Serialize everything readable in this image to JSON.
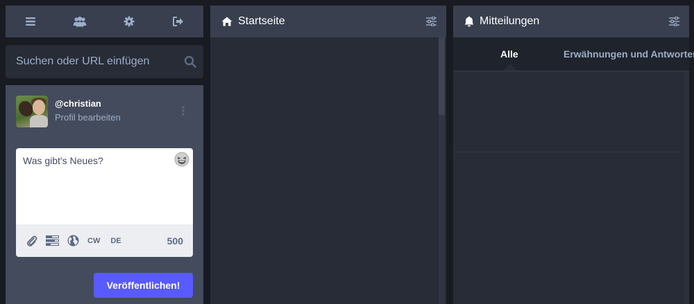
{
  "header": {
    "icons": [
      "menu-icon",
      "users-icon",
      "gear-icon",
      "sign-out-icon"
    ]
  },
  "search": {
    "placeholder": "Suchen oder URL einfügen"
  },
  "account": {
    "username": "@christian",
    "edit_profile": "Profil bearbeiten"
  },
  "compose": {
    "placeholder": "Was gibt's Neues?",
    "cw_label": "CW",
    "lang_label": "DE",
    "char_count": "500",
    "publish_label": "Veröffentlichen!"
  },
  "home": {
    "title": "Startseite",
    "icon": "home-icon"
  },
  "notifications": {
    "title": "Mitteilungen",
    "icon": "bell-icon",
    "filters": [
      "Alle",
      "Erwähnungen und Antworten"
    ]
  },
  "colors": {
    "background": "#191b22",
    "column": "#282c37",
    "header": "#393f4f",
    "compose": "#444b5d",
    "accent": "#595aff",
    "text_secondary": "#9baec8"
  }
}
